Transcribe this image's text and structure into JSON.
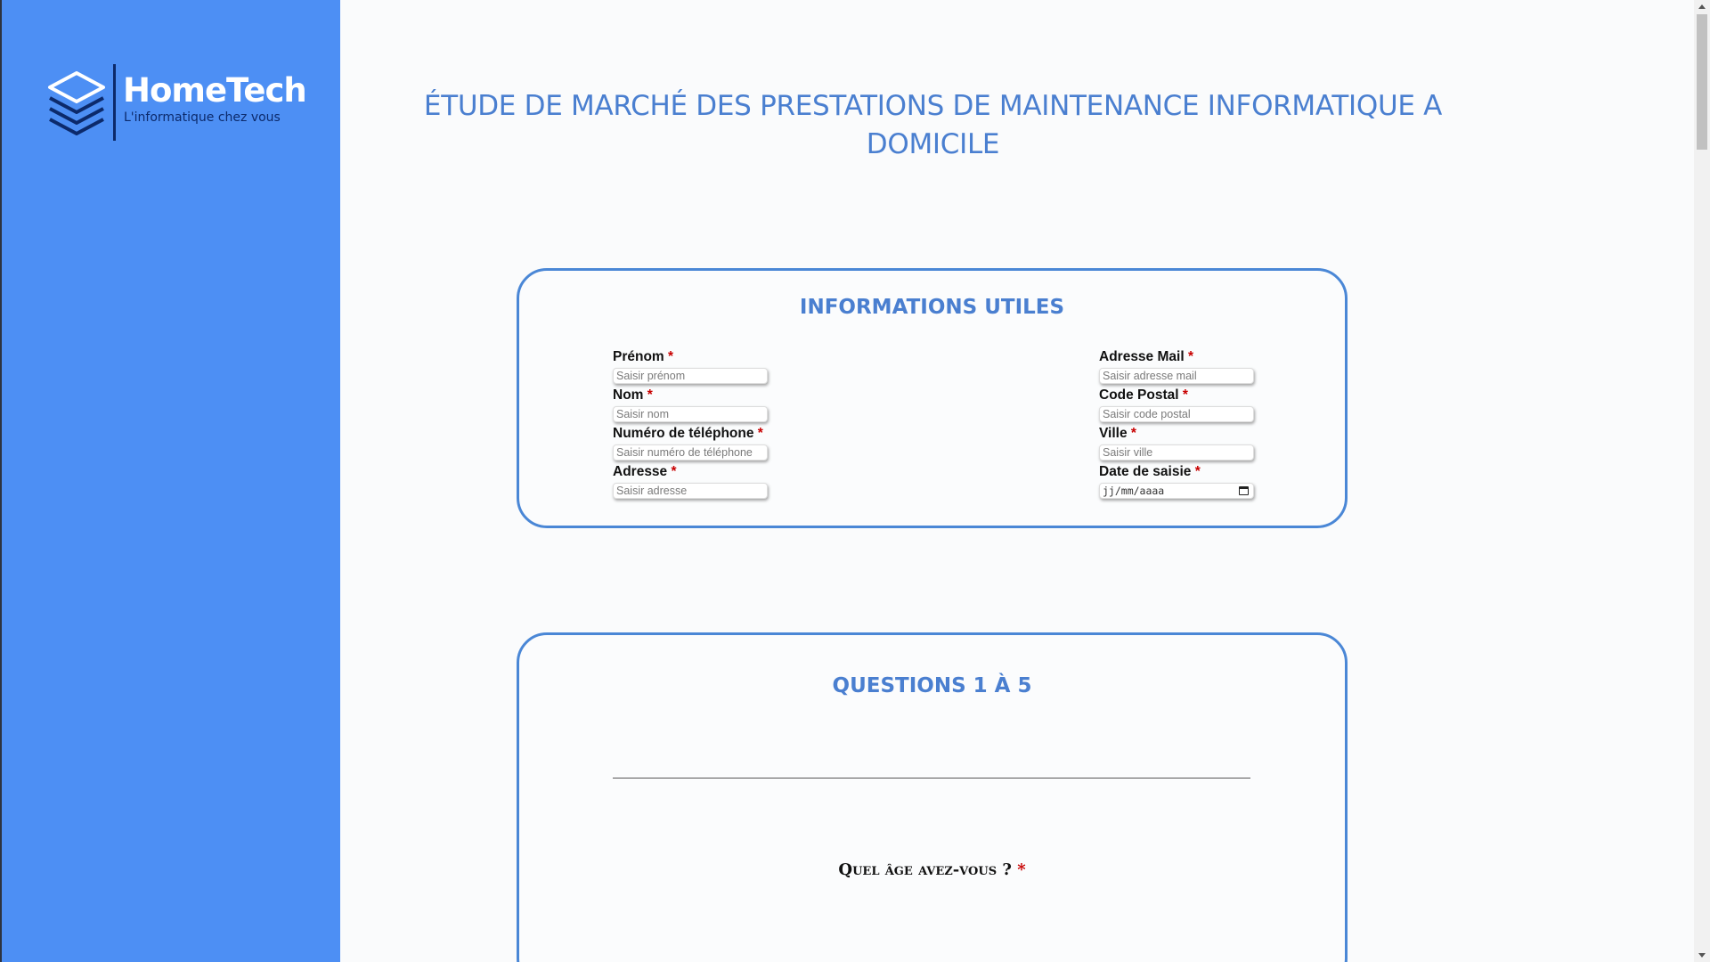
{
  "brand": {
    "name": "HomeTech",
    "tagline": "L'informatique chez vous",
    "colors": {
      "sidebar": "#4d8ff4",
      "accent": "#4a7fd0",
      "required": "#c80000"
    }
  },
  "page": {
    "title": "ÉTUDE DE MARCHÉ DES PRESTATIONS DE MAINTENANCE INFORMATIQUE A DOMICILE"
  },
  "info_section": {
    "title": "INFORMATIONS UTILES",
    "required_mark": "*",
    "left_fields": [
      {
        "label": "Prénom",
        "placeholder": "Saisir prénom"
      },
      {
        "label": "Nom",
        "placeholder": "Saisir nom"
      },
      {
        "label": "Numéro de téléphone",
        "placeholder": "Saisir numéro de téléphone"
      },
      {
        "label": "Adresse",
        "placeholder": "Saisir adresse"
      }
    ],
    "right_fields": [
      {
        "label": "Adresse Mail",
        "placeholder": "Saisir adresse mail"
      },
      {
        "label": "Code Postal",
        "placeholder": "Saisir code postal"
      },
      {
        "label": "Ville",
        "placeholder": "Saisir ville"
      },
      {
        "label": "Date de saisie",
        "placeholder": "jj/mm/aaaa"
      }
    ]
  },
  "questions_section": {
    "title": "QUESTIONS 1 À 5",
    "q1": "Quel âge avez-vous ?",
    "required_mark": "*"
  },
  "icons": {
    "logo": "stacked-layers-icon",
    "date_picker": "calendar-icon"
  }
}
